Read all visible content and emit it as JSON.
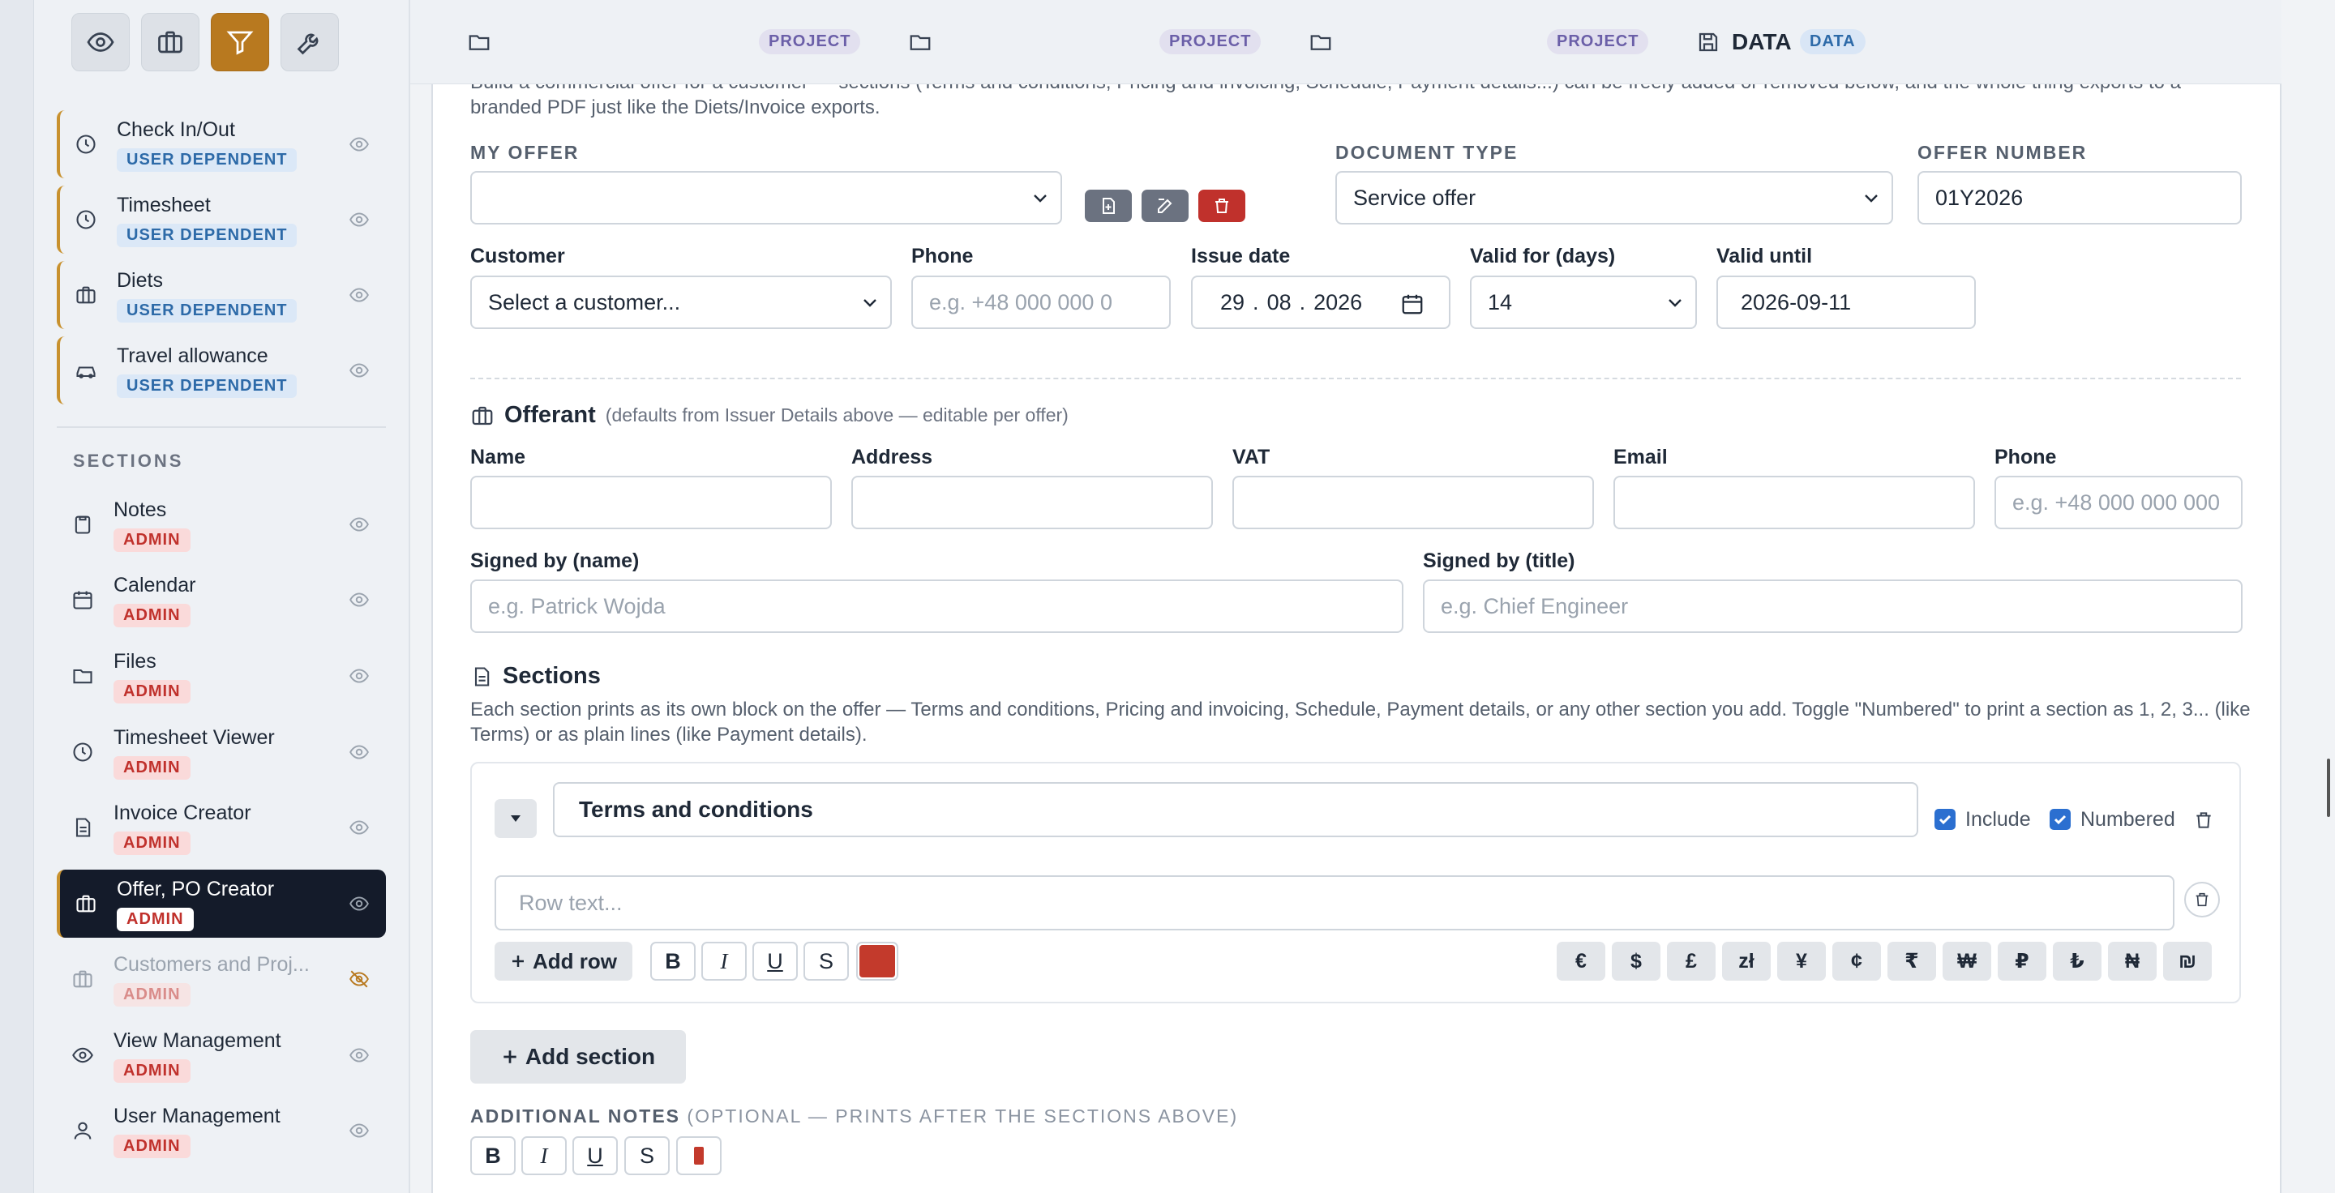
{
  "colors": {
    "accent": "#b8791f",
    "danger": "#c0312c",
    "active_nav": "#141b2a",
    "checkbox": "#2b6fd0",
    "text_color_swatch": "#c33a2c"
  },
  "sidebar": {
    "toolbar": [
      {
        "name": "eye-icon"
      },
      {
        "name": "briefcase-icon"
      },
      {
        "name": "filter-icon"
      },
      {
        "name": "wrench-icon"
      }
    ],
    "top_items": [
      {
        "label": "Check In/Out",
        "badge": "USER DEPENDENT",
        "icon": "clock-icon"
      },
      {
        "label": "Timesheet",
        "badge": "USER DEPENDENT",
        "icon": "clock-icon"
      },
      {
        "label": "Diets",
        "badge": "USER DEPENDENT",
        "icon": "briefcase-icon"
      },
      {
        "label": "Travel allowance",
        "badge": "USER DEPENDENT",
        "icon": "car-icon"
      }
    ],
    "sections_title": "SECTIONS",
    "section_items": [
      {
        "label": "Notes",
        "badge": "ADMIN",
        "icon": "clipboard-icon"
      },
      {
        "label": "Calendar",
        "badge": "ADMIN",
        "icon": "calendar-icon"
      },
      {
        "label": "Files",
        "badge": "ADMIN",
        "icon": "folder-icon"
      },
      {
        "label": "Timesheet Viewer",
        "badge": "ADMIN",
        "icon": "clock-icon"
      },
      {
        "label": "Invoice Creator",
        "badge": "ADMIN",
        "icon": "document-icon"
      },
      {
        "label": "Offer, PO Creator",
        "badge": "ADMIN",
        "icon": "briefcase-icon",
        "active": true
      },
      {
        "label": "Customers and Proj...",
        "badge": "ADMIN",
        "icon": "briefcase-icon",
        "hidden": true
      },
      {
        "label": "View Management",
        "badge": "ADMIN",
        "icon": "eye-icon"
      },
      {
        "label": "User Management",
        "badge": "ADMIN",
        "icon": "user-icon"
      }
    ]
  },
  "topbar": {
    "project_pill": "PROJECT",
    "data_tab_label": "DATA",
    "data_pill": "DATA"
  },
  "main": {
    "intro": "Build a commercial offer for a customer — sections (Terms and conditions, Pricing and invoicing, Schedule, Payment details...) can be freely added or removed below, and the whole thing exports to a branded PDF just like the Diets/Invoice exports.",
    "my_offer_label": "MY OFFER",
    "my_offer_value": "",
    "document_type_label": "DOCUMENT TYPE",
    "document_type_value": "Service offer",
    "offer_number_label": "OFFER NUMBER",
    "offer_number_value": "01Y2026",
    "customer_label": "Customer",
    "customer_value": "Select a customer...",
    "phone_label": "Phone",
    "phone_placeholder": "e.g. +48 000 000 0",
    "issue_date_label": "Issue date",
    "issue_date_day": "29",
    "issue_date_month": "08",
    "issue_date_year": "2026",
    "valid_days_label": "Valid for (days)",
    "valid_days_value": "14",
    "valid_until_label": "Valid until",
    "valid_until_value": "2026-09-11",
    "offerant_title": "Offerant",
    "offerant_note": "(defaults from Issuer Details above — editable per offer)",
    "off_name_label": "Name",
    "off_address_label": "Address",
    "off_vat_label": "VAT",
    "off_email_label": "Email",
    "off_phone_label": "Phone",
    "off_phone_placeholder": "e.g. +48 000 000 000",
    "signed_name_label": "Signed by (name)",
    "signed_name_placeholder": "e.g. Patrick Wojda",
    "signed_title_label": "Signed by (title)",
    "signed_title_placeholder": "e.g. Chief Engineer",
    "sections_title": "Sections",
    "sections_desc": "Each section prints as its own block on the offer — Terms and conditions, Pricing and invoicing, Schedule, Payment details, or any other section you add. Toggle \"Numbered\" to print a section as 1, 2, 3... (like Terms) or as plain lines (like Payment details).",
    "section_card": {
      "title_value": "Terms and conditions",
      "include_label": "Include",
      "numbered_label": "Numbered",
      "row_placeholder": "Row text...",
      "add_row_label": "Add row"
    },
    "format_buttons": [
      "B",
      "I",
      "U",
      "S"
    ],
    "currency_buttons": [
      "€",
      "$",
      "£",
      "zł",
      "¥",
      "¢",
      "₹",
      "₩",
      "₽",
      "₺",
      "₦",
      "₪"
    ],
    "add_section_label": "Add section",
    "additional_notes_label": "ADDITIONAL NOTES",
    "additional_notes_hint": "(OPTIONAL — PRINTS AFTER THE SECTIONS ABOVE)"
  }
}
